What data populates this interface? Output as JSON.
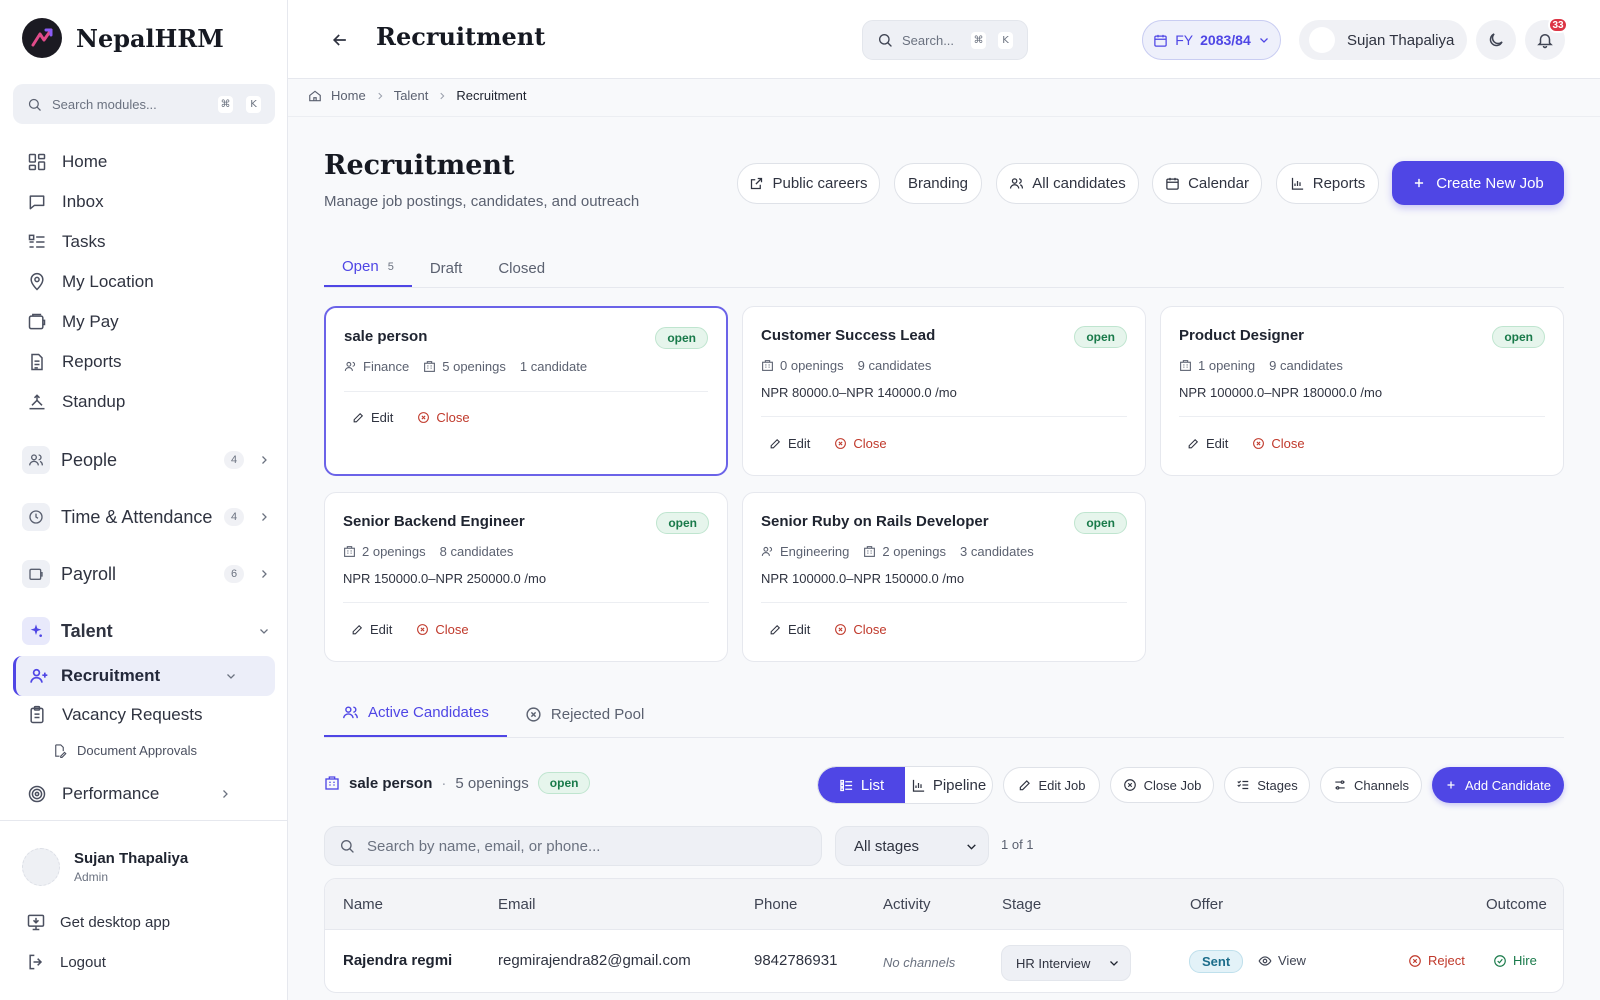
{
  "brand": {
    "name": "NepalHRM"
  },
  "sidebar": {
    "search_placeholder": "Search modules...",
    "shortcut": [
      "⌘",
      "K"
    ],
    "items": [
      {
        "label": "Home",
        "icon": "home-grid-icon"
      },
      {
        "label": "Inbox",
        "icon": "inbox-icon"
      },
      {
        "label": "Tasks",
        "icon": "tasks-icon"
      },
      {
        "label": "My Location",
        "icon": "location-pin-icon"
      },
      {
        "label": "My Pay",
        "icon": "wallet-icon"
      },
      {
        "label": "Reports",
        "icon": "document-icon"
      },
      {
        "label": "Standup",
        "icon": "standup-icon"
      }
    ],
    "groups": [
      {
        "label": "People",
        "count": "4"
      },
      {
        "label": "Time & Attendance",
        "count": "4"
      },
      {
        "label": "Payroll",
        "count": "6"
      },
      {
        "label": "Talent"
      }
    ],
    "recruitment": "Recruitment",
    "vacancy_requests": "Vacancy Requests",
    "document_approvals": "Document Approvals",
    "performance": "Performance",
    "user": {
      "name": "Sujan Thapaliya",
      "role": "Admin"
    },
    "desktop_app": "Get desktop app",
    "logout": "Logout"
  },
  "topbar": {
    "title": "Recruitment",
    "search_placeholder": "Search...",
    "shortcut": [
      "⌘",
      "K"
    ],
    "fy_prefix": "FY",
    "fy_value": "2083/84",
    "user_name": "Sujan Thapaliya",
    "notifications": "33"
  },
  "breadcrumb": [
    "Home",
    "Talent",
    "Recruitment"
  ],
  "page": {
    "title": "Recruitment",
    "subtitle": "Manage job postings, candidates, and outreach",
    "buttons": {
      "public_careers": "Public careers",
      "branding": "Branding",
      "all_candidates": "All candidates",
      "calendar": "Calendar",
      "reports": "Reports",
      "create_job": "Create New Job"
    }
  },
  "job_tabs": [
    {
      "label": "Open",
      "count": "5"
    },
    {
      "label": "Draft"
    },
    {
      "label": "Closed"
    }
  ],
  "jobs": [
    {
      "title": "sale person",
      "status": "open",
      "department": "Finance",
      "openings": "5 openings",
      "candidates": "1 candidate",
      "salary": ""
    },
    {
      "title": "Customer Success Lead",
      "status": "open",
      "department": "",
      "openings": "0 openings",
      "candidates": "9 candidates",
      "salary": "NPR 80000.0–NPR 140000.0 /mo"
    },
    {
      "title": "Product Designer",
      "status": "open",
      "department": "",
      "openings": "1 opening",
      "candidates": "9 candidates",
      "salary": "NPR 100000.0–NPR 180000.0 /mo"
    },
    {
      "title": "Senior Backend Engineer",
      "status": "open",
      "department": "",
      "openings": "2 openings",
      "candidates": "8 candidates",
      "salary": "NPR 150000.0–NPR 250000.0 /mo"
    },
    {
      "title": "Senior Ruby on Rails Developer",
      "status": "open",
      "department": "Engineering",
      "openings": "2 openings",
      "candidates": "3 candidates",
      "salary": "NPR 100000.0–NPR 150000.0 /mo"
    }
  ],
  "job_actions": {
    "edit": "Edit",
    "close": "Close"
  },
  "candidate_tabs": {
    "active": "Active Candidates",
    "rejected": "Rejected Pool"
  },
  "selected_job": {
    "title": "sale person",
    "separator": "·",
    "openings": "5 openings",
    "status": "open"
  },
  "view_toggle": {
    "list": "List",
    "pipeline": "Pipeline"
  },
  "job_buttons": {
    "edit_job": "Edit Job",
    "close_job": "Close Job",
    "stages": "Stages",
    "channels": "Channels",
    "add_candidate": "Add Candidate"
  },
  "candidate_search_placeholder": "Search by name, email, or phone...",
  "stage_filter": "All stages",
  "pager": "1 of 1",
  "table": {
    "headers": [
      "Name",
      "Email",
      "Phone",
      "Activity",
      "Stage",
      "Offer",
      "Outcome"
    ],
    "rows": [
      {
        "name": "Rajendra regmi",
        "email": "regmirajendra82@gmail.com",
        "phone": "9842786931",
        "activity": "No channels",
        "stage": "HR Interview",
        "offer": "Sent",
        "view": "View",
        "reject": "Reject",
        "hire": "Hire"
      }
    ]
  },
  "colors": {
    "accent": "#4f46e5",
    "success": "#197a4a",
    "danger": "#c0392b",
    "info": "#1d6d8b"
  }
}
